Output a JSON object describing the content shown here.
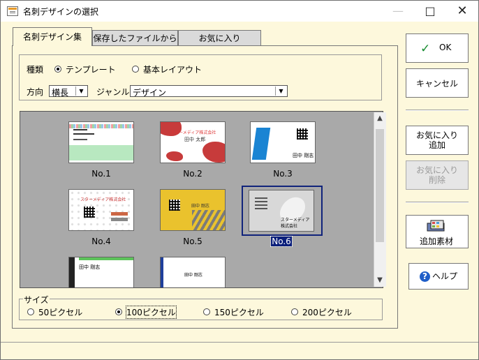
{
  "window": {
    "title": "名刺デザインの選択",
    "icons": [
      "app-window-icon",
      "minimize-icon",
      "maximize-icon",
      "close-icon"
    ]
  },
  "tabs": [
    {
      "label": "名刺デザイン集",
      "active": true
    },
    {
      "label": "保存したファイルから",
      "active": false
    },
    {
      "label": "お気に入り",
      "active": false
    }
  ],
  "filters": {
    "type_label": "種類",
    "template_label": "テンプレート",
    "basic_layout_label": "基本レイアウト",
    "orientation_label": "方向",
    "orientation_value": "横長",
    "genre_label": "ジャンル",
    "genre_value": "デザイン"
  },
  "designs": [
    {
      "label": "No.1"
    },
    {
      "label": "No.2"
    },
    {
      "label": "No.3"
    },
    {
      "label": "No.4"
    },
    {
      "label": "No.5"
    },
    {
      "label": "No.6",
      "selected": true
    },
    {
      "label": ""
    },
    {
      "label": ""
    }
  ],
  "card_text": {
    "name1": "田中 太郎",
    "company1": "スターメディア株式会社",
    "name2": "田中 剛志",
    "name3": "田中 剛志",
    "company2": "スターメディア株式会社",
    "company3": "スターメディア株式会社",
    "name4": "田中 剛志",
    "name5": "田中 剛志",
    "company4": "スターメディア株式会社"
  },
  "size": {
    "title": "サイズ",
    "options": [
      {
        "label": "50ピクセル"
      },
      {
        "label": "100ピクセル",
        "selected": true
      },
      {
        "label": "150ピクセル"
      },
      {
        "label": "200ピクセル"
      }
    ]
  },
  "buttons": {
    "ok": "OK",
    "cancel": "キャンセル",
    "add_favorite": "お気に入り\n追加",
    "remove_favorite": "お気に入り\n削除",
    "add_material": "追加素材",
    "help": "ヘルプ"
  },
  "colors": {
    "background": "#fdf8dc",
    "selection": "#10237b",
    "gallery": "#a9a9a9"
  }
}
